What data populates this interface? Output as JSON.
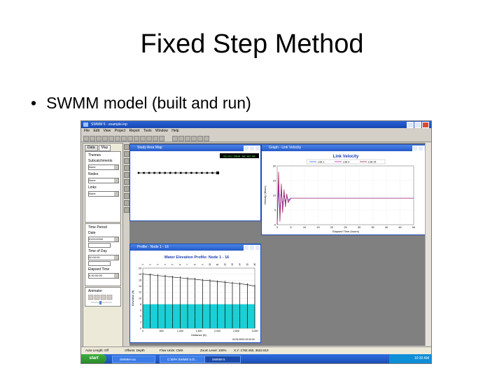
{
  "slide": {
    "title": "Fixed Step Method",
    "bullet": "SWMM model (built and run)"
  },
  "app": {
    "title": "SWMM 5 - example.inp",
    "menu": [
      "File",
      "Edit",
      "View",
      "Project",
      "Report",
      "Tools",
      "Window",
      "Help"
    ]
  },
  "browser": {
    "tabs": [
      "Data",
      "Map"
    ],
    "themes_label": "Themes",
    "subcatchments_label": "Subcatchments",
    "subcatchments_value": "None",
    "nodes_label": "Nodes",
    "nodes_value": "None",
    "links_label": "Links",
    "links_value": "None",
    "time_period_label": "Time Period",
    "date_label": "Date",
    "date_value": "01/01/2000",
    "time_of_day_label": "Time of Day",
    "time_of_day_value": "00:00:00",
    "elapsed_time_label": "Elapsed Time",
    "elapsed_time_value": "0.00:00:00",
    "animator_label": "Animator"
  },
  "map_window": {
    "title": "Study Area Map",
    "time_badge": "01/01/2000 00:00:00",
    "node_count": 16
  },
  "link_velocity_graph": {
    "window_title": "Graph - Link Velocity",
    "chart_title": "Link Velocity",
    "ylabel": "Velocity (ft/sec)",
    "xlabel": "Elapsed Time (hours)",
    "legend": [
      "Link 1",
      "Link 2",
      "Link 15"
    ],
    "ytick_labels": [
      "20",
      "15",
      "10",
      "5",
      "0"
    ],
    "xtick_labels": [
      "0",
      "5",
      "10",
      "15",
      "20",
      "25",
      "30",
      "35",
      "40",
      "45",
      "50"
    ]
  },
  "profile_window": {
    "title": "Profile - Node 1 - 16",
    "chart_title": "Water Elevation Profile: Node 1 - 16",
    "ylabel": "Elevation (ft)",
    "xlabel": "Distance (ft)",
    "ytick_labels": [
      "20",
      "18",
      "16",
      "14",
      "12",
      "10",
      "8",
      "6",
      "4",
      "2",
      "0"
    ],
    "xtick_labels": [
      "0",
      "500",
      "1,000",
      "1,500",
      "2,000",
      "2,500",
      "3,000"
    ],
    "timestamp": "01/01/2000 00:00:00",
    "node_labels": [
      "1",
      "2",
      "3",
      "4",
      "5",
      "6",
      "7",
      "8",
      "9",
      "10",
      "11",
      "12",
      "13",
      "14",
      "15",
      "16"
    ]
  },
  "statusbar": {
    "auto_length": "Auto-Length: Off",
    "offsets": "Offsets: Depth",
    "flow_units": "Flow Units: CMS",
    "zoom": "Zoom Level: 100%",
    "coords": "X,Y: 1782.450, 3622.910"
  },
  "taskbar": {
    "start_label": "start",
    "tasks": [
      "SWMM-rua",
      "C:\\EPA SWMM 5.0\\...",
      "SWMM 5"
    ],
    "clock": "10:30 AM"
  },
  "chart_data": [
    {
      "type": "line",
      "title": "Link Velocity",
      "xlabel": "Elapsed Time (hours)",
      "ylabel": "Velocity (ft/sec)",
      "xlim": [
        0,
        50
      ],
      "ylim": [
        0,
        20
      ],
      "series": [
        {
          "name": "Link 1",
          "color": "#3b62d8",
          "x": [
            0,
            0.5,
            1,
            1.5,
            2,
            2.5,
            3,
            3.5,
            4,
            5,
            6,
            8,
            10,
            20,
            30,
            40,
            50
          ],
          "y": [
            0,
            12,
            5,
            11,
            7,
            10,
            8,
            9.5,
            8.5,
            9,
            9,
            9,
            9,
            9,
            9,
            9,
            9
          ]
        },
        {
          "name": "Link 2",
          "color": "#c020c0",
          "x": [
            0,
            0.5,
            1,
            1.5,
            2,
            2.5,
            3,
            3.5,
            4,
            5,
            6,
            8,
            10,
            20,
            30,
            40,
            50
          ],
          "y": [
            0,
            15,
            3,
            13,
            5,
            11,
            7,
            10,
            8,
            9,
            9,
            9,
            9,
            9,
            9,
            9,
            9
          ]
        },
        {
          "name": "Link 15",
          "color": "#a02060",
          "x": [
            0,
            0.5,
            1,
            1.5,
            2,
            2.5,
            3,
            3.5,
            4,
            5,
            6,
            8,
            10,
            20,
            30,
            40,
            50
          ],
          "y": [
            0,
            18,
            1,
            14,
            4,
            12,
            6,
            10.5,
            7.5,
            9,
            9,
            9,
            9,
            9,
            9,
            9,
            9
          ]
        }
      ]
    },
    {
      "type": "area",
      "title": "Water Elevation Profile: Node 1 - 16",
      "xlabel": "Distance (ft)",
      "ylabel": "Elevation (ft)",
      "xlim": [
        0,
        3000
      ],
      "ylim": [
        0,
        20
      ],
      "node_x": [
        0,
        200,
        400,
        600,
        800,
        1000,
        1200,
        1400,
        1600,
        1800,
        2000,
        2200,
        2400,
        2600,
        2800,
        3000
      ],
      "crown_elevation": [
        18,
        17.8,
        17.5,
        17.3,
        17,
        16.8,
        16.5,
        16.3,
        16,
        15.8,
        15.5,
        15.3,
        15,
        14.8,
        14.5,
        14
      ],
      "water_elevation": [
        8,
        8,
        8,
        8,
        8,
        8,
        8,
        8,
        8,
        8,
        8,
        8,
        8,
        8,
        8,
        8
      ],
      "invert_elevation": [
        0,
        0,
        0,
        0,
        0,
        0,
        0,
        0,
        0,
        0,
        0,
        0,
        0,
        0,
        0,
        0
      ]
    }
  ]
}
